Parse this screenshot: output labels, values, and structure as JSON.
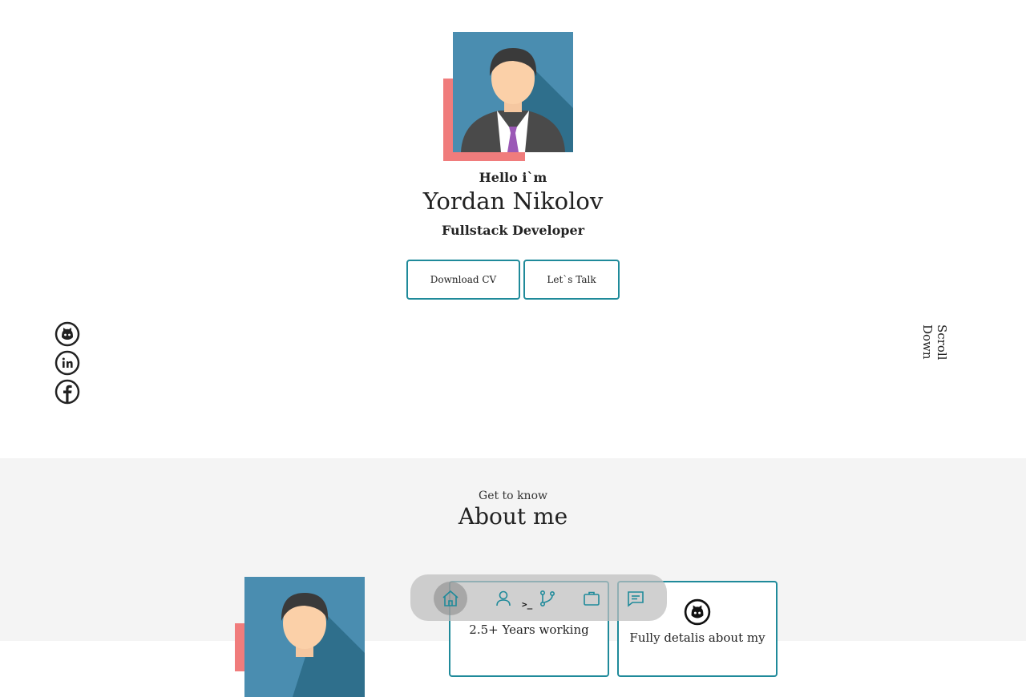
{
  "hero": {
    "greeting": "Hello i`m",
    "name": "Yordan Nikolov",
    "role": "Fullstack Developer",
    "buttons": {
      "download_cv": "Download CV",
      "lets_talk": "Let`s Talk"
    },
    "scroll_down": "Scroll Down"
  },
  "socials": [
    {
      "icon": "github-icon"
    },
    {
      "icon": "linkedin-icon"
    },
    {
      "icon": "facebook-icon"
    }
  ],
  "about": {
    "kicker": "Get to know",
    "title": "About me",
    "cards": {
      "experience": "2.5+ Years working",
      "github": "Fully detalis about my"
    }
  },
  "nav": {
    "items": [
      "home-icon",
      "user-icon",
      "git-branch-icon",
      "briefcase-icon",
      "message-icon"
    ],
    "active": "home-icon",
    "terminal_glyph": ">_"
  },
  "colors": {
    "accent": "#1f8a9a",
    "photo_accent": "#f07c7c",
    "photo_bg": "#4a8db0",
    "section_bg": "#f4f4f4"
  }
}
